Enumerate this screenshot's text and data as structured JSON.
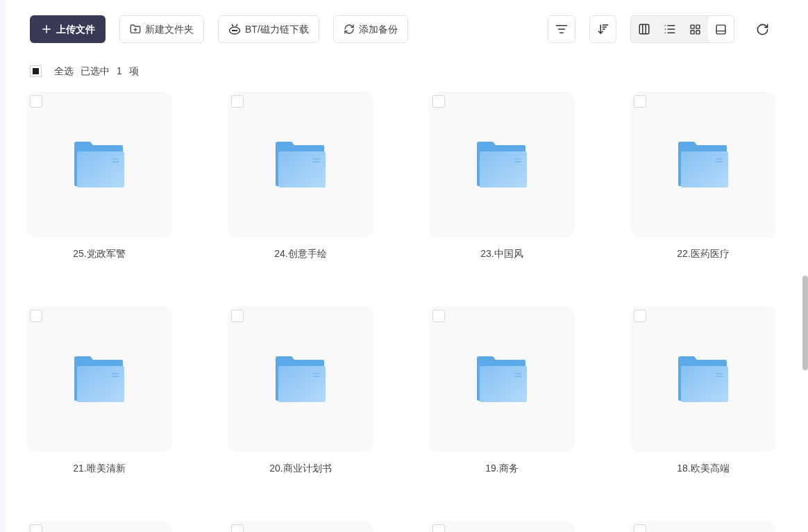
{
  "toolbar": {
    "buttons": [
      {
        "kind": "primary",
        "label": "上传文件"
      },
      {
        "kind": "outline",
        "label": "新建文件夹"
      },
      {
        "kind": "outline",
        "label": "BT/磁力链下载"
      },
      {
        "kind": "outline",
        "label": "添加备份"
      }
    ],
    "views": [
      {
        "selected": false
      },
      {
        "selected": false
      },
      {
        "selected": false
      },
      {
        "selected": true
      }
    ]
  },
  "selection": {
    "label": "全选",
    "indeterminate": true,
    "summary": [
      "已选中",
      "1",
      "项"
    ]
  },
  "items": [
    {
      "name": "25.党政军警",
      "checked": false
    },
    {
      "name": "24.创意手绘",
      "checked": false
    },
    {
      "name": "23.中国风",
      "checked": false
    },
    {
      "name": "22.医药医疗",
      "checked": false
    },
    {
      "name": "21.唯美清新",
      "checked": false
    },
    {
      "name": "20.商业计划书",
      "checked": false
    },
    {
      "name": "19.商务",
      "checked": false
    },
    {
      "name": "18.欧美高端",
      "checked": false
    },
    {
      "checked": false
    },
    {
      "checked": false
    },
    {
      "checked": false
    },
    {
      "checked": false
    }
  ]
}
